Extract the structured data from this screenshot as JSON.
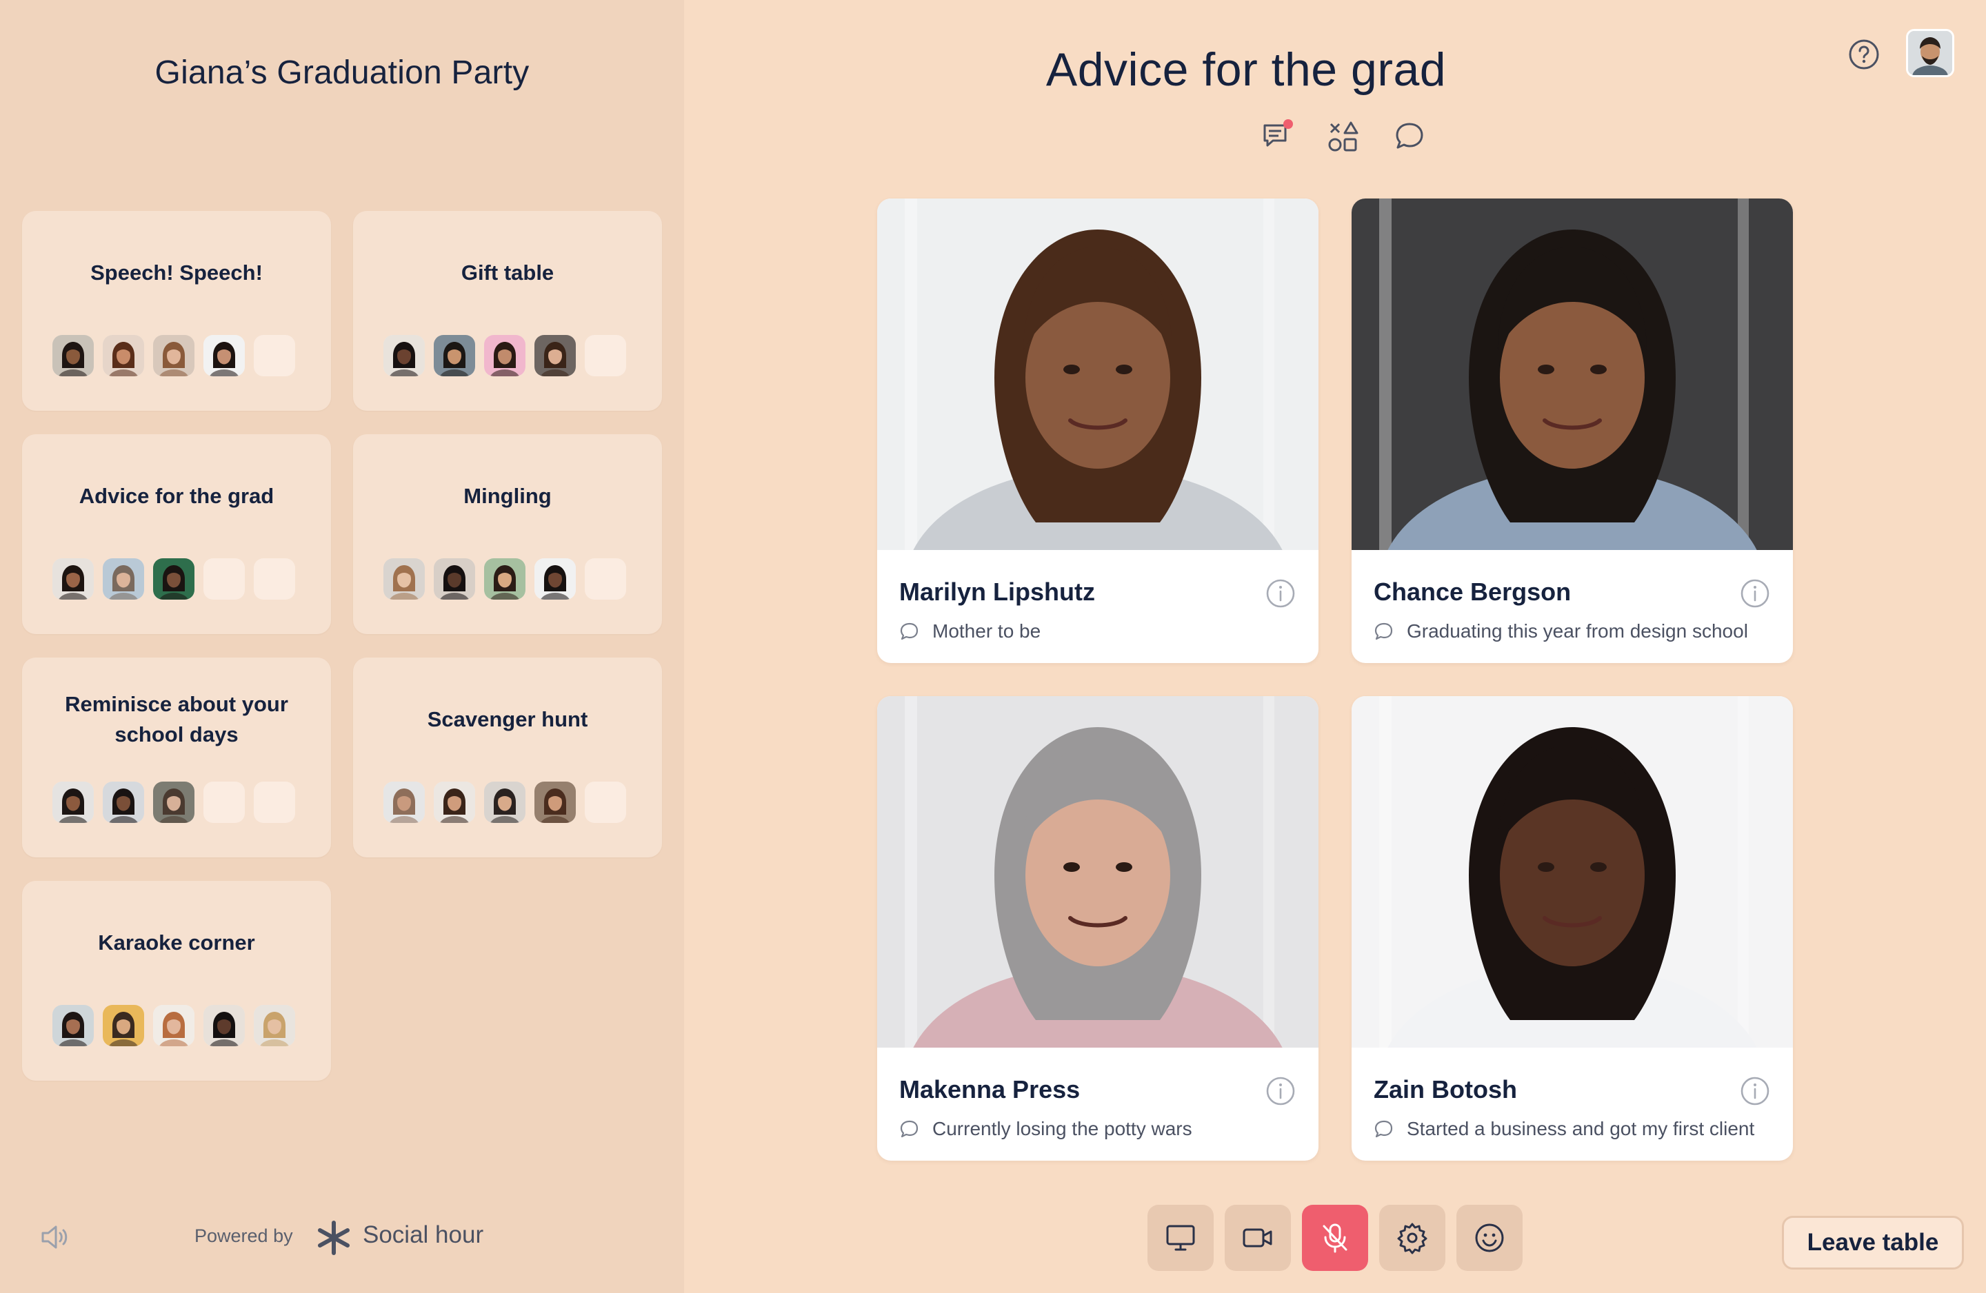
{
  "sidebar": {
    "event_title": "Giana’s Graduation Party",
    "tables": [
      {
        "name": "Speech! Speech!",
        "seats": [
          {
            "skin": "#8a5a3c",
            "hair": "#1e1512",
            "bg": "#c9c2b8"
          },
          {
            "skin": "#c98c6a",
            "hair": "#5a2e1a",
            "bg": "#e6d5c9"
          },
          {
            "skin": "#e1b69b",
            "hair": "#8a5a3a",
            "bg": "#d8c8bb"
          },
          {
            "skin": "#c69073",
            "hair": "#1c1310",
            "bg": "#f2f2f2"
          },
          null
        ]
      },
      {
        "name": "Gift table",
        "seats": [
          {
            "skin": "#6b4230",
            "hair": "#171110",
            "bg": "#e9e3dc"
          },
          {
            "skin": "#c9946e",
            "hair": "#1b1714",
            "bg": "#7d8c97"
          },
          {
            "skin": "#c18b6c",
            "hair": "#2a1a14",
            "bg": "#f1b7cd"
          },
          {
            "skin": "#dcae92",
            "hair": "#3a2418",
            "bg": "#6d6561"
          },
          null
        ]
      },
      {
        "name": "Advice for the grad",
        "seats": [
          {
            "skin": "#9a6447",
            "hair": "#1d1410",
            "bg": "#e7e2dd"
          },
          {
            "skin": "#dcb49a",
            "hair": "#7a6a5e",
            "bg": "#b9c9d6"
          },
          {
            "skin": "#7a5039",
            "hair": "#1a1411",
            "bg": "#2e6e4c"
          },
          null,
          null
        ]
      },
      {
        "name": "Mingling",
        "seats": [
          {
            "skin": "#e6c2a6",
            "hair": "#a0724f",
            "bg": "#d9d4cf"
          },
          {
            "skin": "#5a3a2b",
            "hair": "#151010",
            "bg": "#d8cfc7"
          },
          {
            "skin": "#d9a982",
            "hair": "#2b1c16",
            "bg": "#a6c0a0"
          },
          {
            "skin": "#6f4633",
            "hair": "#161110",
            "bg": "#f1f1f1"
          },
          null
        ]
      },
      {
        "name": "Reminisce about your school days",
        "seats": [
          {
            "skin": "#8c5a3e",
            "hair": "#1c1513",
            "bg": "#e5e3e1"
          },
          {
            "skin": "#7a4f38",
            "hair": "#191312",
            "bg": "#d6d9dd"
          },
          {
            "skin": "#d7b098",
            "hair": "#4a3a30",
            "bg": "#7c7c72"
          },
          null,
          null
        ]
      },
      {
        "name": "Scavenger hunt",
        "seats": [
          {
            "skin": "#c99a7e",
            "hair": "#8e6e5a",
            "bg": "#e6e6e6"
          },
          {
            "skin": "#cf9c7c",
            "hair": "#3a2419",
            "bg": "#ece7e2"
          },
          {
            "skin": "#d8aa8a",
            "hair": "#2a2220",
            "bg": "#d9d4cf"
          },
          {
            "skin": "#cf9b7a",
            "hair": "#4a2c1e",
            "bg": "#96806e"
          },
          null
        ]
      },
      {
        "name": "Karaoke corner",
        "seats": [
          {
            "skin": "#a66f52",
            "hair": "#1d1513",
            "bg": "#cfd6d9"
          },
          {
            "skin": "#d9a880",
            "hair": "#3a2a20",
            "bg": "#e9b85a"
          },
          {
            "skin": "#e2b79d",
            "hair": "#b86d40",
            "bg": "#f1ece6"
          },
          {
            "skin": "#5e3b2c",
            "hair": "#141010",
            "bg": "#e8e1da"
          },
          {
            "skin": "#e5c0a3",
            "hair": "#c9a36c",
            "bg": "#e9e4de"
          }
        ]
      }
    ],
    "powered_by": "Powered by",
    "brand": "Social hour",
    "icons": {
      "sound": "speaker-icon",
      "brand": "asterisk-logo-icon"
    }
  },
  "main": {
    "title": "Advice for the grad",
    "toolbar_icons": [
      "chat-notes-icon",
      "shapes-icon",
      "comment-icon"
    ],
    "help_icon": "help-icon",
    "participants": [
      {
        "name": "Marilyn Lipshutz",
        "status": "Mother to be",
        "skin": "#8a5a3f",
        "hair": "#4a2b1a",
        "shirt": "#c9cdd2",
        "bg": "#eef0f1"
      },
      {
        "name": "Chance Bergson",
        "status": "Graduating this year from design school",
        "skin": "#8b5a3e",
        "hair": "#1b1512",
        "shirt": "#8ea1b8",
        "bg": "#3e3e40"
      },
      {
        "name": "Makenna Press",
        "status": "Currently losing the potty wars",
        "skin": "#d9ab95",
        "hair": "#9a9899",
        "shirt": "#d6b0b6",
        "bg": "#e4e4e6"
      },
      {
        "name": "Zain Botosh",
        "status": "Started a business and got my first client",
        "skin": "#5a3525",
        "hair": "#1a1210",
        "shirt": "#f2f3f5",
        "bg": "#f4f4f5"
      }
    ],
    "controls": [
      "screen-share-icon",
      "camera-icon",
      "mic-muted-icon",
      "settings-icon",
      "emoji-icon"
    ],
    "leave_label": "Leave table",
    "colors": {
      "mute": "#ef5e6e",
      "background": "#f8dcc4",
      "sidebar": "#f0d4bd"
    }
  }
}
